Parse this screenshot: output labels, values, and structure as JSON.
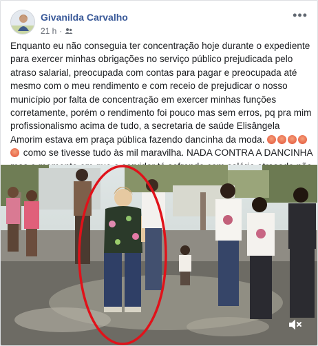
{
  "post": {
    "author": "Givanilda Carvalho",
    "time": "21 h",
    "audience_icon": "friends-icon",
    "text_part1": "Enquanto eu não conseguia ter concentração hoje durante o expediente para exercer minhas obrigações no serviço público prejudicada pelo atraso salarial, preocupada com contas para pagar e preocupada até mesmo com o meu rendimento e com receio de prejudicar o nosso município por falta de concentração em exercer minhas funções corretamente, porém o rendimento foi pouco mas sem erros, pq pra mim profissionalismo acima de tudo, a secretaria de saúde Elisângela Amorim estava em praça pública fazendo dancinha da moda. ",
    "emoji_name": "angry-face-emoji",
    "emoji_count": 5,
    "text_part2": " como se tivesse tudo às mil maravilha. NADA CONTRA A DANCINHA mas o momento em que o servidor tá sofrendo com salário atrasado não acho nada legal."
  },
  "video": {
    "mute_icon": "speaker-muted-icon",
    "highlight_color": "#e0121a"
  },
  "colors": {
    "author_link": "#385898",
    "text": "#1c1e21",
    "meta": "#616770"
  }
}
